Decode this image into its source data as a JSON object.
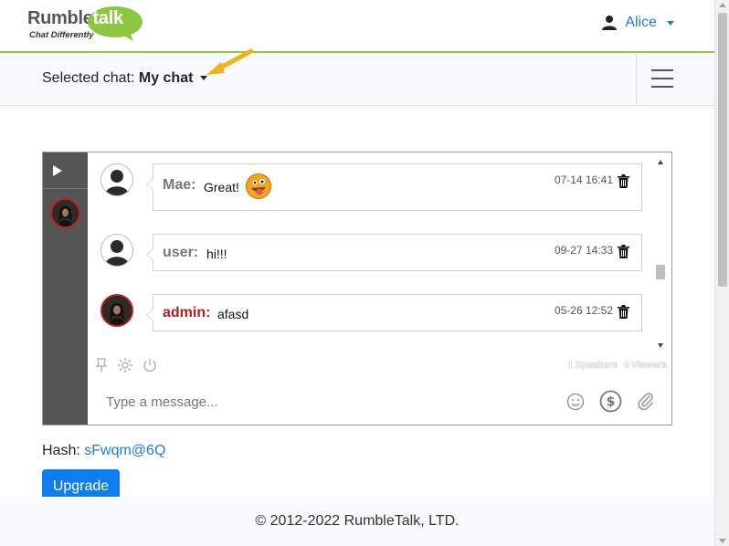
{
  "header": {
    "logo": {
      "word1": "Rumble",
      "word2": "talk",
      "tagline": "Chat Differently"
    },
    "user_name": "Alice"
  },
  "chatbar": {
    "label": "Selected chat:",
    "chat_name": "My chat"
  },
  "chat": {
    "messages": [
      {
        "user": "Mae:",
        "text": "Great!",
        "time": "07-14 16:41",
        "emoji": "tongue-out-emoji"
      },
      {
        "user": "user:",
        "text": "hi!!!",
        "time": "09-27 14:33"
      },
      {
        "user": "admin:",
        "text": "afasd",
        "time": "05-26 12:52"
      }
    ],
    "stats": {
      "speakers_count": "1",
      "speakers_label": "Speakers",
      "viewers_count": "0",
      "viewers_label": "Viewers"
    },
    "input_placeholder": "Type a message..."
  },
  "hash": {
    "label": "Hash:",
    "value": "sFwqm@6Q"
  },
  "upgrade_label": "Upgrade",
  "footer": {
    "copyright": "© 2012-2022 RumbleTalk, LTD."
  },
  "colors": {
    "accent_green": "#8dc63f",
    "link_blue": "#1a7de0",
    "admin_red": "#b01e1e",
    "sidebar_gray": "#555555"
  }
}
